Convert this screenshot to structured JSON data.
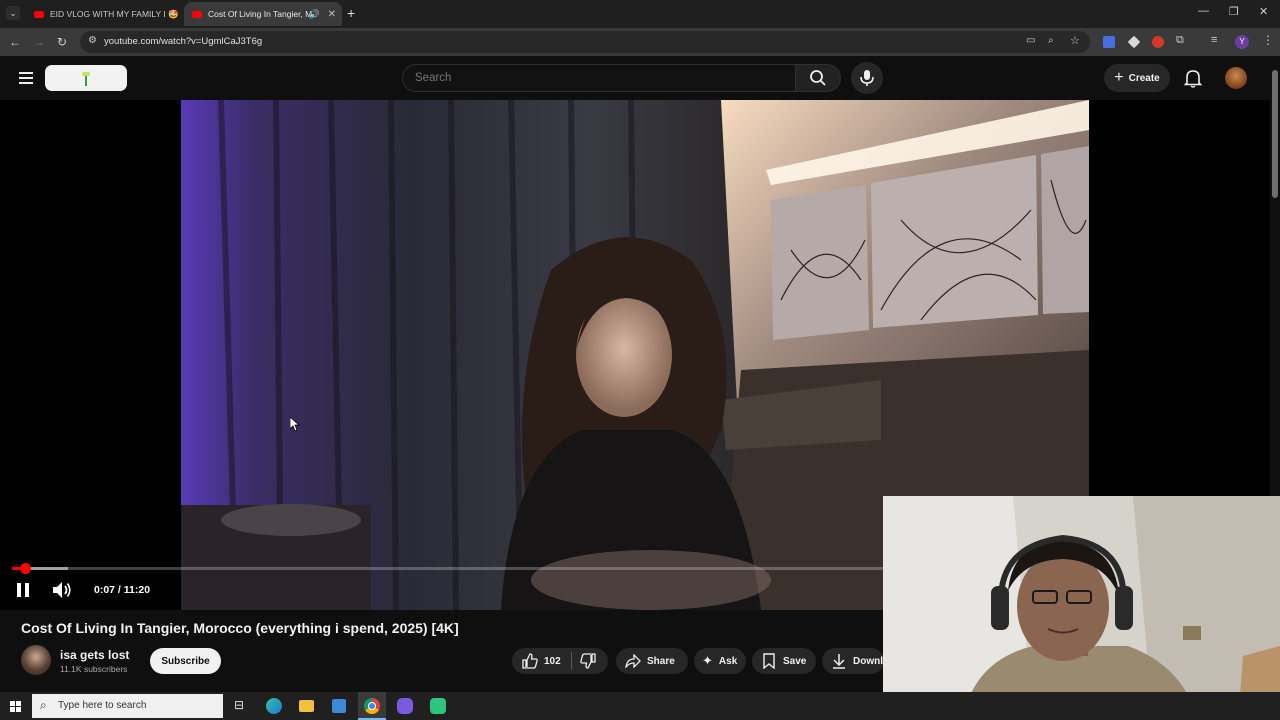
{
  "browser": {
    "tabs": [
      {
        "title": "EID VLOG WITH MY FAMILY I 🤩",
        "active": false
      },
      {
        "title": "Cost Of Living In Tangier, M",
        "active": true
      }
    ],
    "url": "youtube.com/watch?v=UgmlCaJ3T6g",
    "profile_initial": "Y"
  },
  "youtube": {
    "search_placeholder": "Search",
    "create_label": "Create"
  },
  "player": {
    "time": "0:07 / 11:20",
    "progress": 0.0103
  },
  "video": {
    "title": "Cost Of Living In Tangier, Morocco (everything i spend, 2025) [4K]",
    "channel": "isa gets lost",
    "subscribers": "11.1K subscribers",
    "subscribe_label": "Subscribe",
    "likes": "102",
    "share_label": "Share",
    "ask_label": "Ask",
    "save_label": "Save",
    "download_label": "Downl"
  },
  "taskbar": {
    "search_placeholder": "Type here to search"
  },
  "colors": {
    "accent": "#ff0000",
    "background": "#0f0f0f",
    "pill": "#272727"
  }
}
